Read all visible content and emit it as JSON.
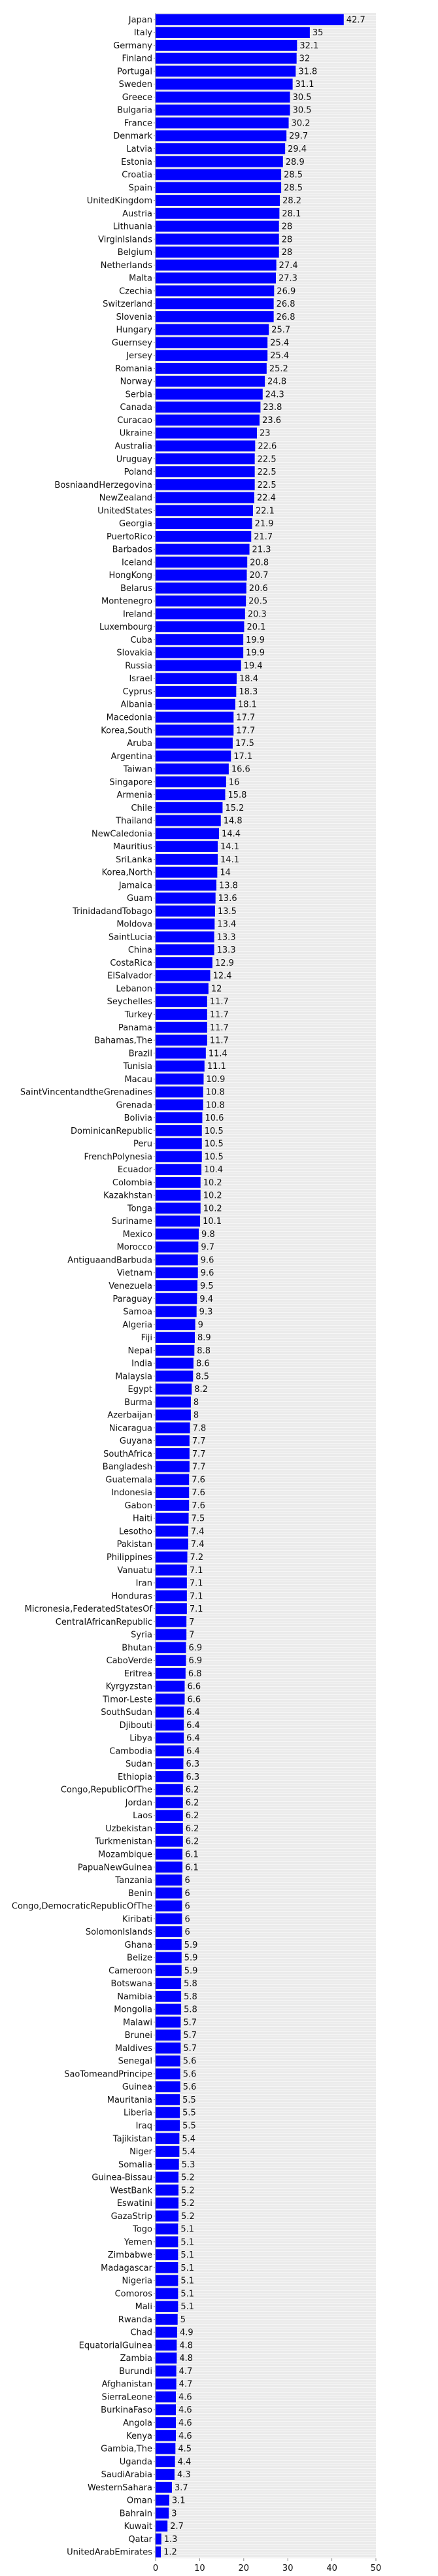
{
  "chart_data": {
    "type": "bar",
    "orientation": "horizontal",
    "title": "",
    "xlabel": "",
    "ylabel": "",
    "xlim": [
      0,
      50
    ],
    "xticks": [
      0,
      10,
      20,
      30,
      40,
      50
    ],
    "grid": true,
    "bar_color": "#0000ff",
    "background_color": "#ebebeb",
    "categories": [
      "Japan",
      "Italy",
      "Germany",
      "Finland",
      "Portugal",
      "Sweden",
      "Greece",
      "Bulgaria",
      "France",
      "Denmark",
      "Latvia",
      "Estonia",
      "Croatia",
      "Spain",
      "UnitedKingdom",
      "Austria",
      "Lithuania",
      "VirginIslands",
      "Belgium",
      "Netherlands",
      "Malta",
      "Czechia",
      "Switzerland",
      "Slovenia",
      "Hungary",
      "Guernsey",
      "Jersey",
      "Romania",
      "Norway",
      "Serbia",
      "Canada",
      "Curacao",
      "Ukraine",
      "Australia",
      "Uruguay",
      "Poland",
      "BosniaandHerzegovina",
      "NewZealand",
      "UnitedStates",
      "Georgia",
      "PuertoRico",
      "Barbados",
      "Iceland",
      "HongKong",
      "Belarus",
      "Montenegro",
      "Ireland",
      "Luxembourg",
      "Cuba",
      "Slovakia",
      "Russia",
      "Israel",
      "Cyprus",
      "Albania",
      "Macedonia",
      "Korea,South",
      "Aruba",
      "Argentina",
      "Taiwan",
      "Singapore",
      "Armenia",
      "Chile",
      "Thailand",
      "NewCaledonia",
      "Mauritius",
      "SriLanka",
      "Korea,North",
      "Jamaica",
      "Guam",
      "TrinidadandTobago",
      "Moldova",
      "SaintLucia",
      "China",
      "CostaRica",
      "ElSalvador",
      "Lebanon",
      "Seychelles",
      "Turkey",
      "Panama",
      "Bahamas,The",
      "Brazil",
      "Tunisia",
      "Macau",
      "SaintVincentandtheGrenadines",
      "Grenada",
      "Bolivia",
      "DominicanRepublic",
      "Peru",
      "FrenchPolynesia",
      "Ecuador",
      "Colombia",
      "Kazakhstan",
      "Tonga",
      "Suriname",
      "Mexico",
      "Morocco",
      "AntiguaandBarbuda",
      "Vietnam",
      "Venezuela",
      "Paraguay",
      "Samoa",
      "Algeria",
      "Fiji",
      "Nepal",
      "India",
      "Malaysia",
      "Egypt",
      "Burma",
      "Azerbaijan",
      "Nicaragua",
      "Guyana",
      "SouthAfrica",
      "Bangladesh",
      "Guatemala",
      "Indonesia",
      "Gabon",
      "Haiti",
      "Lesotho",
      "Pakistan",
      "Philippines",
      "Vanuatu",
      "Iran",
      "Honduras",
      "Micronesia,FederatedStatesOf",
      "CentralAfricanRepublic",
      "Syria",
      "Bhutan",
      "CaboVerde",
      "Eritrea",
      "Kyrgyzstan",
      "Timor-Leste",
      "SouthSudan",
      "Djibouti",
      "Libya",
      "Cambodia",
      "Sudan",
      "Ethiopia",
      "Congo,RepublicOfThe",
      "Jordan",
      "Laos",
      "Uzbekistan",
      "Turkmenistan",
      "Mozambique",
      "PapuaNewGuinea",
      "Tanzania",
      "Benin",
      "Congo,DemocraticRepublicOfThe",
      "Kiribati",
      "SolomonIslands",
      "Ghana",
      "Belize",
      "Cameroon",
      "Botswana",
      "Namibia",
      "Mongolia",
      "Malawi",
      "Brunei",
      "Maldives",
      "Senegal",
      "SaoTomeandPrincipe",
      "Guinea",
      "Mauritania",
      "Liberia",
      "Iraq",
      "Tajikistan",
      "Niger",
      "Somalia",
      "Guinea-Bissau",
      "WestBank",
      "Eswatini",
      "GazaStrip",
      "Togo",
      "Yemen",
      "Zimbabwe",
      "Madagascar",
      "Nigeria",
      "Comoros",
      "Mali",
      "Rwanda",
      "Chad",
      "EquatorialGuinea",
      "Zambia",
      "Burundi",
      "Afghanistan",
      "SierraLeone",
      "BurkinaFaso",
      "Angola",
      "Kenya",
      "Gambia,The",
      "Uganda",
      "SaudiArabia",
      "WesternSahara",
      "Oman",
      "Bahrain",
      "Kuwait",
      "Qatar",
      "UnitedArabEmirates"
    ],
    "values": [
      42.7,
      35,
      32.1,
      32,
      31.8,
      31.1,
      30.5,
      30.5,
      30.2,
      29.7,
      29.4,
      28.9,
      28.5,
      28.5,
      28.2,
      28.1,
      28,
      28,
      28,
      27.4,
      27.3,
      26.9,
      26.8,
      26.8,
      25.7,
      25.4,
      25.4,
      25.2,
      24.8,
      24.3,
      23.8,
      23.6,
      23,
      22.6,
      22.5,
      22.5,
      22.5,
      22.4,
      22.1,
      21.9,
      21.7,
      21.3,
      20.8,
      20.7,
      20.6,
      20.5,
      20.3,
      20.1,
      19.9,
      19.9,
      19.4,
      18.4,
      18.3,
      18.1,
      17.7,
      17.7,
      17.5,
      17.1,
      16.6,
      16,
      15.8,
      15.2,
      14.8,
      14.4,
      14.1,
      14.1,
      14,
      13.8,
      13.6,
      13.5,
      13.4,
      13.3,
      13.3,
      12.9,
      12.4,
      12,
      11.7,
      11.7,
      11.7,
      11.7,
      11.4,
      11.1,
      10.9,
      10.8,
      10.8,
      10.6,
      10.5,
      10.5,
      10.5,
      10.4,
      10.2,
      10.2,
      10.2,
      10.1,
      9.8,
      9.7,
      9.6,
      9.6,
      9.5,
      9.4,
      9.3,
      9,
      8.9,
      8.8,
      8.6,
      8.5,
      8.2,
      8,
      8,
      7.8,
      7.7,
      7.7,
      7.7,
      7.6,
      7.6,
      7.6,
      7.5,
      7.4,
      7.4,
      7.2,
      7.1,
      7.1,
      7.1,
      7.1,
      7,
      7,
      6.9,
      6.9,
      6.8,
      6.6,
      6.6,
      6.4,
      6.4,
      6.4,
      6.4,
      6.3,
      6.3,
      6.2,
      6.2,
      6.2,
      6.2,
      6.2,
      6.1,
      6.1,
      6,
      6,
      6,
      6,
      6,
      5.9,
      5.9,
      5.9,
      5.8,
      5.8,
      5.8,
      5.7,
      5.7,
      5.7,
      5.6,
      5.6,
      5.6,
      5.5,
      5.5,
      5.5,
      5.4,
      5.4,
      5.3,
      5.2,
      5.2,
      5.2,
      5.2,
      5.1,
      5.1,
      5.1,
      5.1,
      5.1,
      5.1,
      5.1,
      5,
      4.9,
      4.8,
      4.8,
      4.7,
      4.7,
      4.6,
      4.6,
      4.6,
      4.6,
      4.5,
      4.4,
      4.3,
      3.7,
      3.1,
      3,
      2.7,
      1.3,
      1.2
    ]
  }
}
